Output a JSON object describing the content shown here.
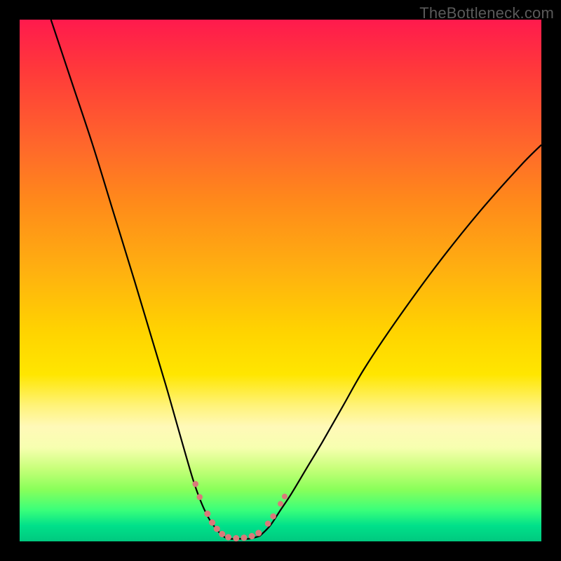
{
  "watermark": "TheBottleneck.com",
  "colors": {
    "background": "#000000",
    "gradient_top": "#ff1a4d",
    "gradient_bottom": "#00c97f",
    "curve": "#000000",
    "marker": "#d97a7a"
  },
  "chart_data": {
    "type": "line",
    "title": "",
    "xlabel": "",
    "ylabel": "",
    "xlim": [
      0,
      100
    ],
    "ylim": [
      0,
      100
    ],
    "grid": false,
    "legend": false,
    "series": [
      {
        "name": "left-curve",
        "x": [
          6,
          10,
          14,
          18,
          22,
          25,
          28,
          30,
          32,
          33.5,
          35,
          36.5,
          38,
          39
        ],
        "y": [
          100,
          88,
          76,
          63,
          50,
          40,
          30,
          23,
          16,
          11,
          7,
          4,
          2,
          1
        ]
      },
      {
        "name": "right-curve",
        "x": [
          46,
          48,
          50,
          52,
          55,
          58,
          62,
          66,
          72,
          80,
          88,
          96,
          100
        ],
        "y": [
          1,
          3,
          6,
          9,
          14,
          19,
          26,
          33,
          42,
          53,
          63,
          72,
          76
        ]
      },
      {
        "name": "valley-floor",
        "x": [
          39,
          40,
          42,
          44,
          46
        ],
        "y": [
          1,
          0.5,
          0.5,
          0.5,
          1
        ]
      }
    ],
    "markers": [
      {
        "series": "left-curve",
        "x": 33.7,
        "y": 11,
        "r": 3.2
      },
      {
        "series": "left-curve",
        "x": 34.5,
        "y": 8.5,
        "r": 3.2
      },
      {
        "series": "left-curve",
        "x": 36.0,
        "y": 5.3,
        "r": 3.4
      },
      {
        "series": "left-curve",
        "x": 36.9,
        "y": 3.6,
        "r": 3.4
      },
      {
        "series": "left-curve",
        "x": 37.8,
        "y": 2.4,
        "r": 3.4
      },
      {
        "series": "valley-floor",
        "x": 38.8,
        "y": 1.4,
        "r": 3.4
      },
      {
        "series": "valley-floor",
        "x": 40.0,
        "y": 0.8,
        "r": 3.4
      },
      {
        "series": "valley-floor",
        "x": 41.5,
        "y": 0.6,
        "r": 3.4
      },
      {
        "series": "valley-floor",
        "x": 43.0,
        "y": 0.7,
        "r": 3.4
      },
      {
        "series": "valley-floor",
        "x": 44.5,
        "y": 1.0,
        "r": 3.4
      },
      {
        "series": "right-curve",
        "x": 45.8,
        "y": 1.6,
        "r": 3.4
      },
      {
        "series": "right-curve",
        "x": 47.6,
        "y": 3.4,
        "r": 3.2
      },
      {
        "series": "right-curve",
        "x": 48.6,
        "y": 4.8,
        "r": 3.2
      },
      {
        "series": "right-curve",
        "x": 50.0,
        "y": 7.2,
        "r": 3.0
      },
      {
        "series": "right-curve",
        "x": 50.8,
        "y": 8.6,
        "r": 3.0
      }
    ]
  }
}
